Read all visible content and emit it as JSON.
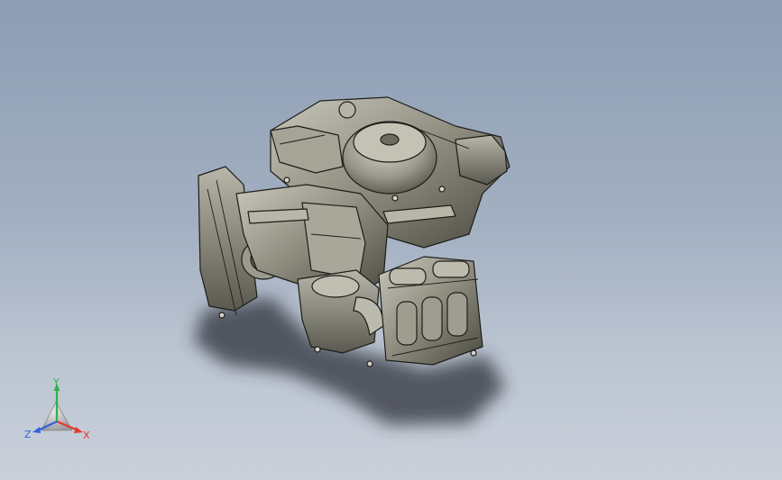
{
  "viewport": {
    "background_top": "#8d9db3",
    "background_bottom": "#c9d0da"
  },
  "model": {
    "icon": "engine-assembly-model",
    "shade_color": "#8e8c7e",
    "edge_color": "#1d1d1a",
    "shadow_color": "#2e323a"
  },
  "triad": {
    "x_label": "X",
    "y_label": "Y",
    "z_label": "Z",
    "x_color": "#e23b2e",
    "y_color": "#2fb24a",
    "z_color": "#2f63d9"
  }
}
